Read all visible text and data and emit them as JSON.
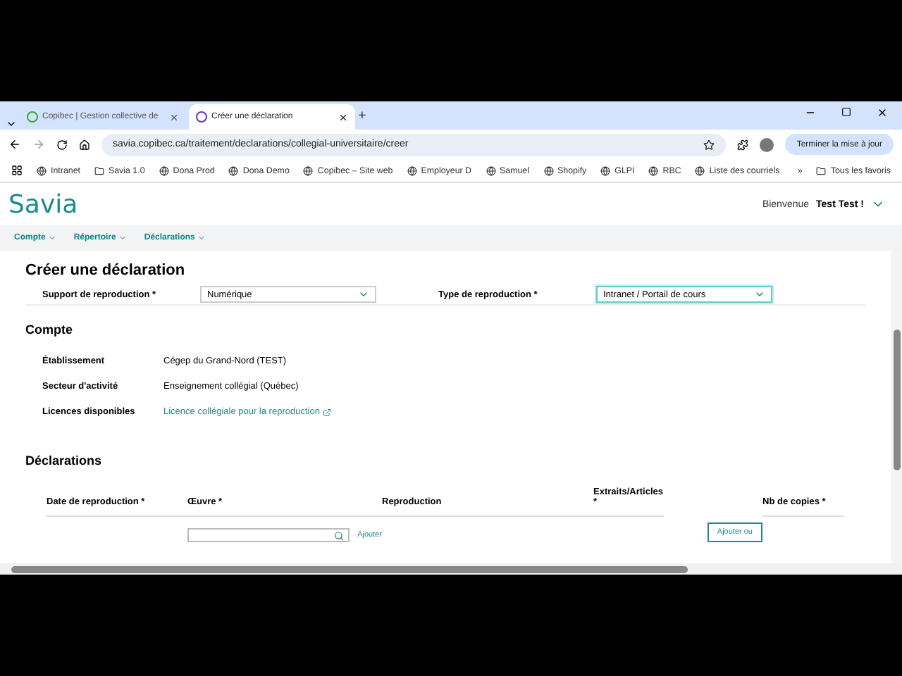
{
  "browser": {
    "tabs": [
      {
        "title": "Copibec | Gestion collective de",
        "selected": false
      },
      {
        "title": "Créer une déclaration",
        "selected": true
      }
    ],
    "new_tab": "+",
    "url": "savia.copibec.ca/traitement/declarations/collegial-universitaire/creer",
    "update_button": "Terminer la mise à jour",
    "bookmarks": [
      "Intranet",
      "Savia 1.0",
      "Dona Prod",
      "Dona Demo",
      "Copibec – Site web",
      "Employeur D",
      "Samuel",
      "Shopify",
      "GLPI",
      "RBC",
      "Liste des courriels"
    ],
    "overflow": "»",
    "all_bookmarks": "Tous les favoris"
  },
  "app": {
    "logo": "Savia",
    "welcome": "Bienvenue",
    "user": "Test Test !",
    "nav": [
      "Compte",
      "Répertoire",
      "Déclarations"
    ]
  },
  "page": {
    "title": "Créer une déclaration",
    "selects": [
      {
        "label": "Support de reproduction *",
        "value": "Numérique",
        "focused": false
      },
      {
        "label": "Type de reproduction *",
        "value": "Intranet / Portail de cours",
        "focused": true
      }
    ],
    "account_title": "Compte",
    "account": [
      {
        "label": "Établissement",
        "value": "Cégep du Grand-Nord (TEST)",
        "kind": "text"
      },
      {
        "label": "Secteur d'activité",
        "value": "Enseignement collégial (Québec)",
        "kind": "text"
      },
      {
        "label": "Licences disponibles",
        "value": "Licence collégiale pour la reproduction",
        "kind": "link"
      }
    ],
    "declarations_title": "Déclarations",
    "columns": [
      "Date de reproduction *",
      "Œuvre *",
      "Reproduction",
      "Extraits/Articles *",
      "Nb de copies *"
    ],
    "row": {
      "add_work": "Ajouter",
      "add_extract": "Ajouter ou"
    }
  }
}
